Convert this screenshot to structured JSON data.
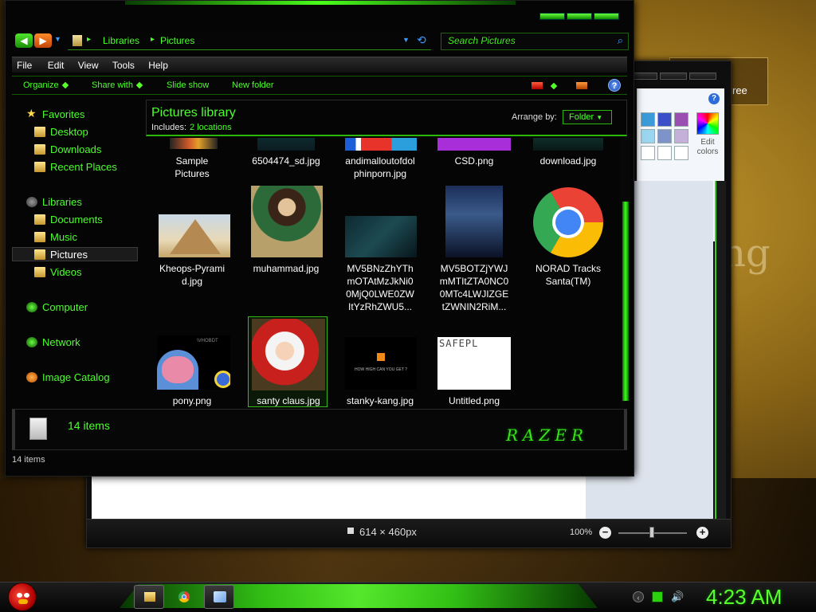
{
  "desktop": {
    "wallpaper_text": "ng",
    "banner_text": "ree"
  },
  "paint": {
    "help": "?",
    "edit_colors": "Edit colors",
    "swatch_colors": [
      "#3a9bd8",
      "#3b4fc8",
      "#9b4fb0",
      "#9ad6f0",
      "#7d93c9",
      "#c4b0d8",
      "#ffffff",
      "#ffffff",
      "#ffffff"
    ],
    "image_size": "614 × 460px",
    "zoom": "100%",
    "zoom_minus": "−",
    "zoom_plus": "+"
  },
  "explorer": {
    "breadcrumbs": [
      "Libraries",
      "Pictures"
    ],
    "breadcrumb_sep": "▸",
    "search_placeholder": "Search Pictures",
    "menu": [
      "File",
      "Edit",
      "View",
      "Tools",
      "Help"
    ],
    "toolbar": {
      "organize": "Organize",
      "share_with": "Share with",
      "slide_show": "Slide show",
      "new_folder": "New folder",
      "help": "?"
    },
    "nav": [
      {
        "label": "Favorites",
        "icon": "star-icon"
      },
      {
        "label": "Desktop",
        "icon": "folder-icon"
      },
      {
        "label": "Downloads",
        "icon": "folder-icon"
      },
      {
        "label": "Recent Places",
        "icon": "folder-icon"
      },
      {
        "label": "Libraries",
        "icon": "libraries-icon"
      },
      {
        "label": "Documents",
        "icon": "folder-icon"
      },
      {
        "label": "Music",
        "icon": "folder-icon"
      },
      {
        "label": "Pictures",
        "icon": "folder-icon",
        "selected": true
      },
      {
        "label": "Videos",
        "icon": "folder-icon"
      },
      {
        "label": "Computer",
        "icon": "computer-icon"
      },
      {
        "label": "Network",
        "icon": "network-icon"
      },
      {
        "label": "Image Catalog",
        "icon": "lightning-icon"
      }
    ],
    "library_title": "Pictures library",
    "includes_label": "Includes:",
    "includes_locations": "2 locations",
    "arrange_label": "Arrange by:",
    "arrange_value": "Folder",
    "files": [
      {
        "name": "Sample Pictures",
        "l1": "Sample",
        "l2": "Pictures"
      },
      {
        "name": "6504474_sd.jpg",
        "l1": "6504474_sd.jpg"
      },
      {
        "name": "andimalloutofdolphinporn.jpg",
        "l1": "andimalloutofdol",
        "l2": "phinporn.jpg"
      },
      {
        "name": "CSD.png",
        "l1": "CSD.png"
      },
      {
        "name": "download.jpg",
        "l1": "download.jpg"
      },
      {
        "name": "Kheops-Pyramid.jpg",
        "l1": "Kheops-Pyrami",
        "l2": "d.jpg"
      },
      {
        "name": "muhammad.jpg",
        "l1": "muhammad.jpg"
      },
      {
        "name": "MV5BNzZhYThmOTAtMzJkNi00MjQ0LWE0ZWItYzRhZWU5...",
        "l1": "MV5BNzZhYTh",
        "l2": "mOTAtMzJkNi0",
        "l3": "0MjQ0LWE0ZW",
        "l4": "ItYzRhZWU5..."
      },
      {
        "name": "MV5BOTZjYWJmMTItZTA0NC00MTc4LWJIZGEtZWNIN2RiM...",
        "l1": "MV5BOTZjYWJ",
        "l2": "mMTItZTA0NC0",
        "l3": "0MTc4LWJIZGE",
        "l4": "tZWNIN2RiM..."
      },
      {
        "name": "NORAD Tracks Santa(TM)",
        "l1": "NORAD Tracks",
        "l2": "Santa(TM)"
      },
      {
        "name": "pony.png",
        "l1": "pony.png"
      },
      {
        "name": "santy claus.jpg",
        "l1": "santy claus.jpg",
        "selected": true
      },
      {
        "name": "stanky-kang.jpg",
        "l1": "stanky-kang.jpg"
      },
      {
        "name": "Untitled.png",
        "l1": "Untitled.png"
      }
    ],
    "thumb_text": {
      "untitled": "SAFEPL",
      "stanky": "HOW HIGH CAN YOU GET ?",
      "pony_caption": "\\VHOBDT"
    },
    "details_count": "14 items",
    "brand": "RAZER",
    "status_count": "14 items"
  },
  "taskbar": {
    "clock": "4:23 AM",
    "tray_arrow": "‹",
    "volume": "🔊"
  }
}
